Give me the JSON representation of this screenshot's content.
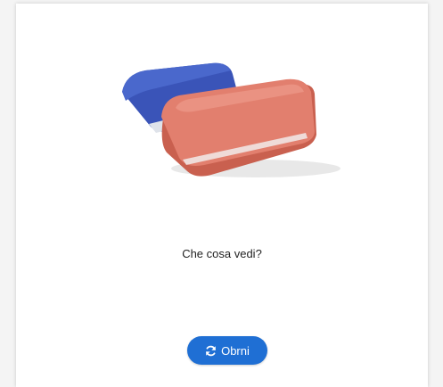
{
  "card": {
    "image_alt": "eraser",
    "question": "Che cosa vedi?",
    "flip_button_label": "Obrni",
    "flip_icon": "refresh-icon"
  },
  "colors": {
    "button": "#1f6fd4",
    "eraser_pink": "#e27f6e",
    "eraser_blue": "#3a54b8"
  }
}
